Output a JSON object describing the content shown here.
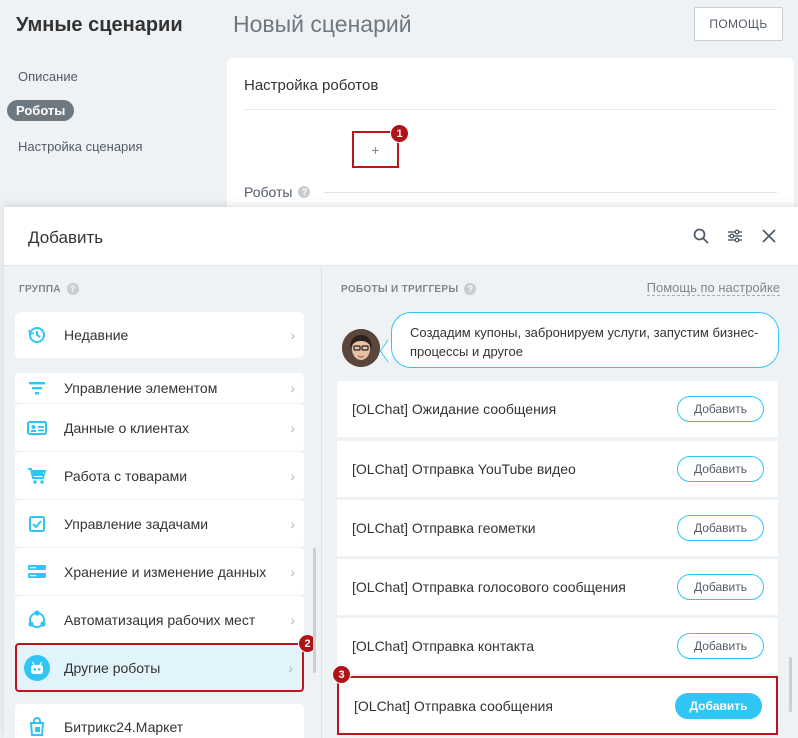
{
  "app_title": "Умные сценарии",
  "page_heading": "Новый сценарий",
  "help_button": "ПОМОЩЬ",
  "sidebar": {
    "items": [
      {
        "label": "Описание"
      },
      {
        "label": "Роботы"
      },
      {
        "label": "Настройка сценария"
      }
    ]
  },
  "card": {
    "title": "Настройка роботов",
    "plus": "+",
    "robots_label": "Роботы"
  },
  "badges": [
    "1",
    "2",
    "3"
  ],
  "panel": {
    "title": "Добавить",
    "group_header": "ГРУППА",
    "right_header": "РОБОТЫ И ТРИГГЕРЫ",
    "help_link": "Помощь по настройке",
    "chat_text": "Создадим купоны, забронируем услуги, запустим бизнес-процессы и другое",
    "groups": [
      {
        "label": "Недавние",
        "icon": "history-icon"
      },
      {
        "label": "Управление элементом",
        "icon": "filter-icon"
      },
      {
        "label": "Данные о клиентах",
        "icon": "contact-card-icon"
      },
      {
        "label": "Работа с товарами",
        "icon": "cart-icon"
      },
      {
        "label": "Управление задачами",
        "icon": "task-icon"
      },
      {
        "label": "Хранение и изменение данных",
        "icon": "storage-icon"
      },
      {
        "label": "Автоматизация рабочих мест",
        "icon": "workflow-icon"
      },
      {
        "label": "Другие роботы",
        "icon": "robot-icon"
      },
      {
        "label": "Битрикс24.Маркет",
        "icon": "market-bag-icon"
      }
    ],
    "robots": [
      {
        "label": "[OLChat] Ожидание сообщения",
        "button": "Добавить"
      },
      {
        "label": "[OLChat] Отправка YouTube видео",
        "button": "Добавить"
      },
      {
        "label": "[OLChat] Отправка геометки",
        "button": "Добавить"
      },
      {
        "label": "[OLChat] Отправка голосового сообщения",
        "button": "Добавить"
      },
      {
        "label": "[OLChat] Отправка контакта",
        "button": "Добавить"
      },
      {
        "label": "[OLChat] Отправка сообщения",
        "button": "Добавить"
      }
    ]
  },
  "colors": {
    "accent": "#2fc6f6",
    "highlight": "#b9161b",
    "icon_blue": "#2fc6f6"
  }
}
